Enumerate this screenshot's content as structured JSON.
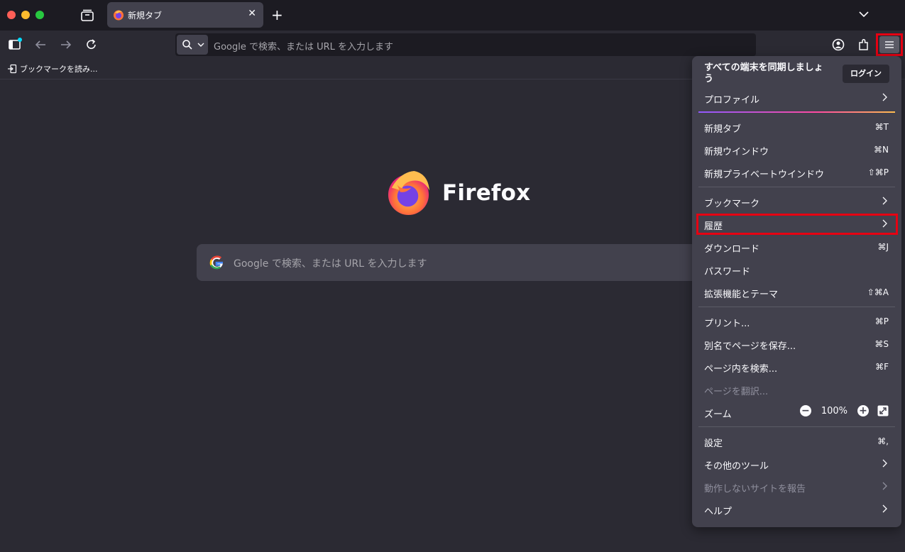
{
  "tab": {
    "title": "新規タブ"
  },
  "urlbar": {
    "placeholder": "Google で検索、または URL を入力します"
  },
  "bookmarks": {
    "import_label": "ブックマークを読み..."
  },
  "content": {
    "brand": "Firefox",
    "search_placeholder": "Google で検索、または URL を入力します"
  },
  "menu": {
    "sync_header": "すべての端末を同期しましょう",
    "login": "ログイン",
    "profile": "プロファイル",
    "new_tab": {
      "label": "新規タブ",
      "shortcut": "⌘T"
    },
    "new_window": {
      "label": "新規ウインドウ",
      "shortcut": "⌘N"
    },
    "new_private": {
      "label": "新規プライベートウインドウ",
      "shortcut": "⇧⌘P"
    },
    "bookmarks": "ブックマーク",
    "history": "履歴",
    "downloads": {
      "label": "ダウンロード",
      "shortcut": "⌘J"
    },
    "passwords": "パスワード",
    "addons": {
      "label": "拡張機能とテーマ",
      "shortcut": "⇧⌘A"
    },
    "print": {
      "label": "プリント...",
      "shortcut": "⌘P"
    },
    "save_as": {
      "label": "別名でページを保存...",
      "shortcut": "⌘S"
    },
    "find": {
      "label": "ページ内を検索...",
      "shortcut": "⌘F"
    },
    "translate": "ページを翻訳...",
    "zoom": {
      "label": "ズーム",
      "value": "100%",
      "minus": "−",
      "plus": "+"
    },
    "settings": {
      "label": "設定",
      "shortcut": "⌘,"
    },
    "more_tools": "その他のツール",
    "report_site": "動作しないサイトを報告",
    "help": "ヘルプ"
  },
  "colors": {
    "highlight": "#e60012",
    "panel_bg": "#42414d",
    "page_bg": "#2b2a33"
  }
}
